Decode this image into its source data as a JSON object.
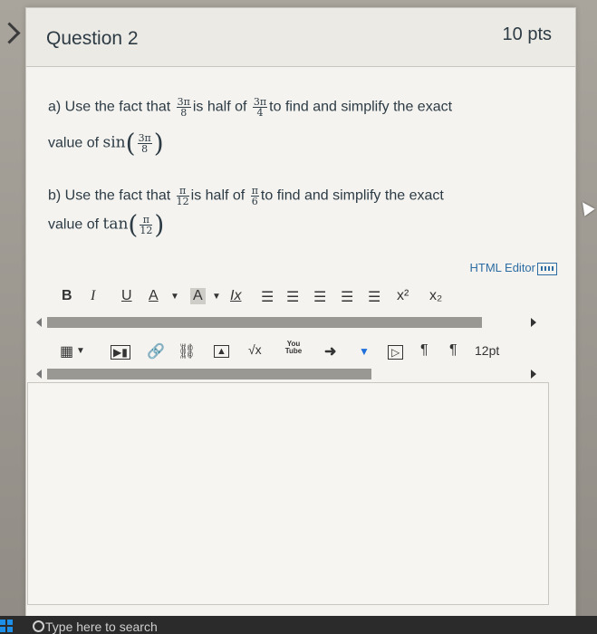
{
  "question": {
    "title": "Question 2",
    "points": "10 pts"
  },
  "part_a": {
    "line1_before": "a) Use the fact that",
    "frac1_num": "3π",
    "frac1_den": "8",
    "mid": "is half of",
    "frac2_num": "3π",
    "frac2_den": "4",
    "line1_after": "to find and simplify the exact",
    "line2_before": "value of",
    "func": "sin",
    "frac3_num": "3π",
    "frac3_den": "8"
  },
  "part_b": {
    "line1_before": "b) Use the fact that",
    "frac1_num": "π",
    "frac1_den": "12",
    "mid": "is half of",
    "frac2_num": "π",
    "frac2_den": "6",
    "line1_after": "to find and simplify the exact",
    "line2_before": "value of",
    "func": "tan",
    "frac3_num": "π",
    "frac3_den": "12"
  },
  "editor": {
    "html_editor_label": "HTML Editor",
    "toolbar1": {
      "bold": "B",
      "italic": "I",
      "underline": "U",
      "font_color": "A",
      "bg_color": "A",
      "clear_format": "Ix",
      "superscript": "x²",
      "subscript": "x₂"
    },
    "toolbar2": {
      "sqrt": "√x",
      "youtube": "You Tube",
      "font_size": "12pt"
    }
  },
  "taskbar": {
    "search_placeholder": "Type here to search"
  }
}
